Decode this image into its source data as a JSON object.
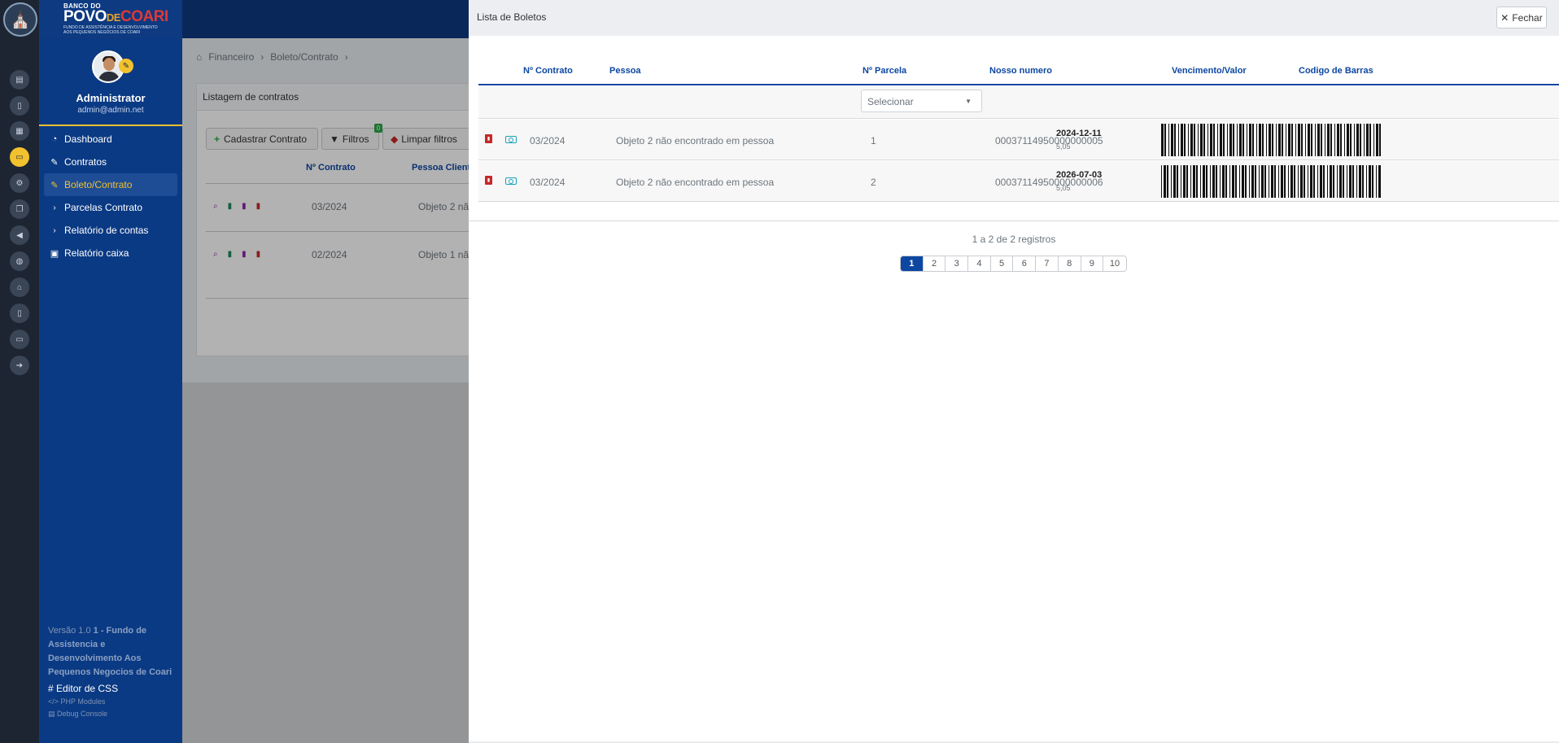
{
  "brand": {
    "top": "BANCO DO",
    "povo": "POVO",
    "de": "DE",
    "coari": "COARI",
    "sub1": "FUNDO DE ASSISTÊNCIA E DESENVOLVIMENTO",
    "sub2": "AOS PEQUENOS NEGÓCIOS DE COARI"
  },
  "profile": {
    "name": "Administrator",
    "email": "admin@admin.net"
  },
  "nav": [
    {
      "label": "Dashboard",
      "icon": "dashboard-icon",
      "expandable": false,
      "active": false
    },
    {
      "label": "Contratos",
      "icon": "edit-icon",
      "expandable": false,
      "active": false
    },
    {
      "label": "Boleto/Contrato",
      "icon": "edit-icon",
      "expandable": false,
      "active": true
    },
    {
      "label": "Parcelas Contrato",
      "icon": "chevron-right-icon",
      "expandable": true,
      "active": false
    },
    {
      "label": "Relatório de contas",
      "icon": "chevron-right-icon",
      "expandable": true,
      "active": false
    },
    {
      "label": "Relatório caixa",
      "icon": "briefcase-icon",
      "expandable": false,
      "active": false
    }
  ],
  "footer": {
    "version": "Versão 1.0",
    "org": "1 - Fundo de Assistencia e Desenvolvimento Aos Pequenos Negocios de Coari",
    "css_editor": "Editor de CSS",
    "php_modules": "PHP Modules",
    "debug": "Debug Console"
  },
  "breadcrumb": [
    "Financeiro",
    "Boleto/Contrato"
  ],
  "list": {
    "title": "Listagem de contratos",
    "add_label": "Cadastrar Contrato",
    "filter_label": "Filtros",
    "filter_count": "0",
    "clear_label": "Limpar filtros",
    "col_contrato": "Nº Contrato",
    "col_pessoa": "Pessoa Client",
    "rows": [
      {
        "contrato": "03/2024",
        "pessoa": "Objeto 2 nã"
      },
      {
        "contrato": "02/2024",
        "pessoa": "Objeto 1 nã"
      }
    ]
  },
  "panel": {
    "title": "Lista de Boletos",
    "close_label": "Fechar",
    "columns": {
      "contrato": "Nº Contrato",
      "pessoa": "Pessoa",
      "parcela": "Nº Parcela",
      "nosso": "Nosso numero",
      "venc": "Vencimento/Valor",
      "barcode": "Codigo de Barras"
    },
    "select_placeholder": "Selecionar",
    "rows": [
      {
        "contrato": "03/2024",
        "pessoa": "Objeto 2 não encontrado em pessoa",
        "parcela": "1",
        "nosso": "00037114950000000005",
        "vencimento": "2024-12-11",
        "valor": "5,05"
      },
      {
        "contrato": "03/2024",
        "pessoa": "Objeto 2 não encontrado em pessoa",
        "parcela": "2",
        "nosso": "00037114950000000006",
        "vencimento": "2026-07-03",
        "valor": "5,05"
      }
    ],
    "records": "1 a 2 de 2 registros",
    "pages": [
      "1",
      "2",
      "3",
      "4",
      "5",
      "6",
      "7",
      "8",
      "9",
      "10"
    ],
    "current_page": "1"
  }
}
